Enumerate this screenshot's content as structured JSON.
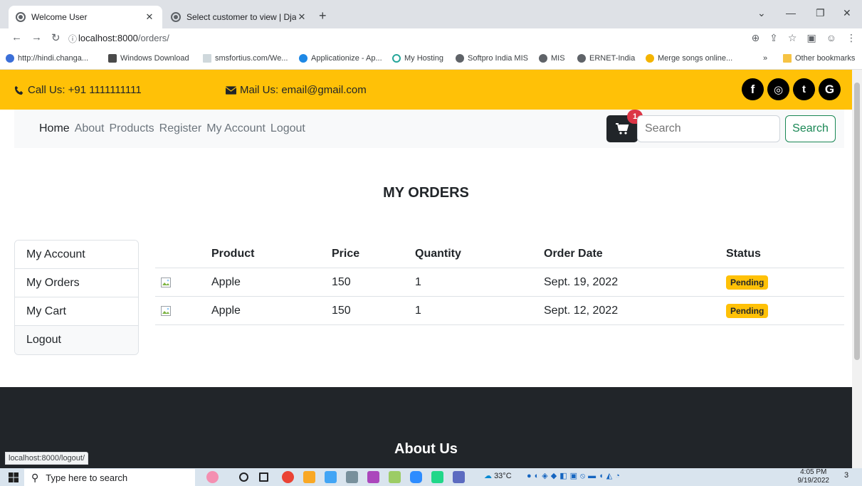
{
  "browser": {
    "tabs": [
      {
        "label": "Welcome User",
        "active": true
      },
      {
        "label": "Select customer to view | Django",
        "active": false
      }
    ],
    "url_host": "localhost:8000",
    "url_path": "/orders/",
    "bookmarks": [
      "http://hindi.changa...",
      "Windows Download",
      "smsfortius.com/We...",
      "Applicationize - Ap...",
      "My Hosting",
      "Softpro India MIS",
      "MIS",
      "ERNET-India",
      "Merge songs online..."
    ],
    "other_bookmarks": "Other bookmarks",
    "status_url": "localhost:8000/logout/"
  },
  "topbar": {
    "call": "Call Us: +91 1111111111",
    "mail": "Mail Us: email@gmail.com",
    "social": [
      "f",
      "◎",
      "t",
      "G"
    ]
  },
  "nav": {
    "links": [
      "Home",
      "About",
      "Products",
      "Register",
      "My Account",
      "Logout"
    ],
    "cart_count": "1",
    "search_placeholder": "Search",
    "search_button": "Search"
  },
  "page": {
    "title": "MY ORDERS"
  },
  "sidemenu": [
    "My Account",
    "My Orders",
    "My Cart",
    "Logout"
  ],
  "orders": {
    "headers": [
      "Product",
      "Price",
      "Quantity",
      "Order Date",
      "Status"
    ],
    "rows": [
      {
        "product": "Apple",
        "price": "150",
        "quantity": "1",
        "date": "Sept. 19, 2022",
        "status": "Pending"
      },
      {
        "product": "Apple",
        "price": "150",
        "quantity": "1",
        "date": "Sept. 12, 2022",
        "status": "Pending"
      }
    ]
  },
  "footer": {
    "title": "About Us"
  },
  "taskbar": {
    "search_placeholder": "Type here to search",
    "temperature": "33°C",
    "time": "4:05 PM",
    "date": "9/19/2022",
    "notifications": "3"
  },
  "colors": {
    "topbar": "#ffc107",
    "footer": "#212529",
    "search_button": "#198754",
    "badge": "#ffc107",
    "cart_badge": "#dc3545"
  }
}
